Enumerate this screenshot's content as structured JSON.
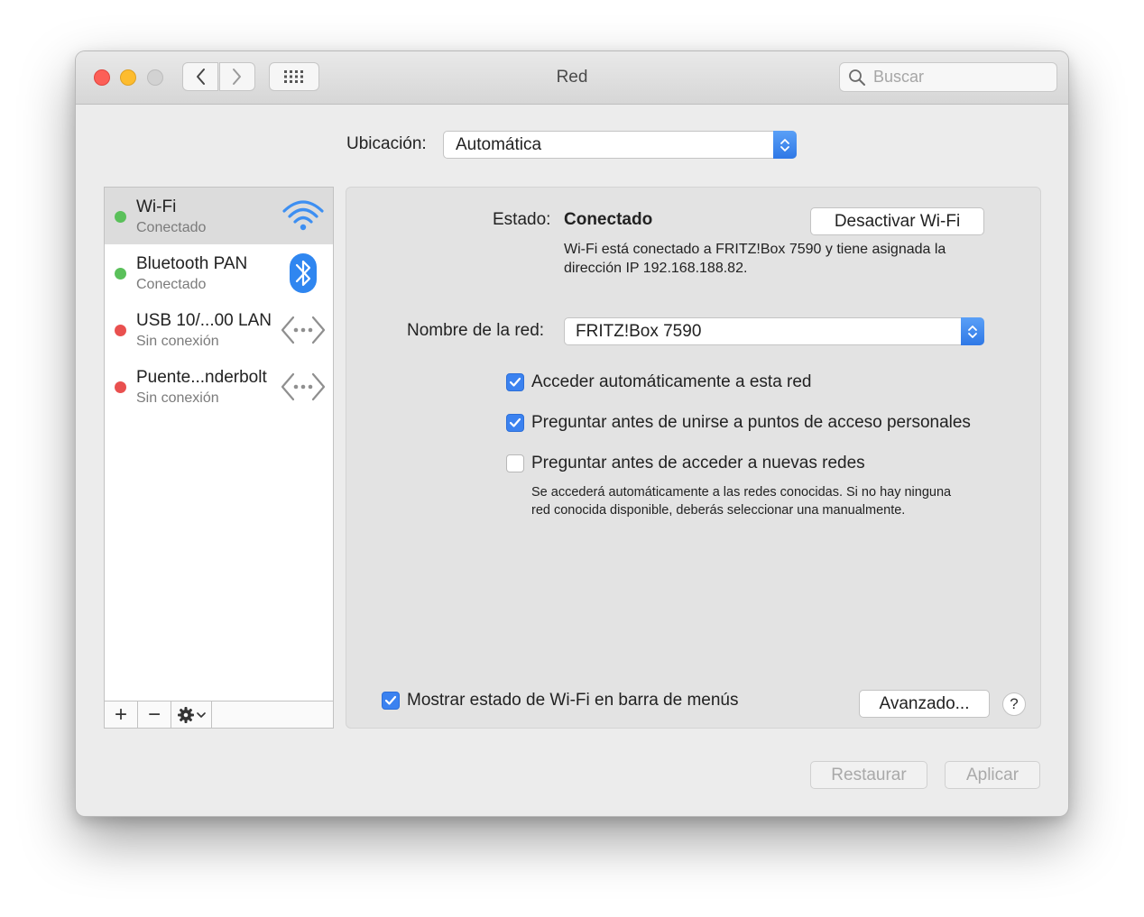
{
  "window": {
    "title": "Red"
  },
  "toolbar": {
    "search_placeholder": "Buscar"
  },
  "location": {
    "label": "Ubicación:",
    "value": "Automática"
  },
  "services": [
    {
      "name": "Wi-Fi",
      "status": "Conectado",
      "status_color": "#5ac05a",
      "icon": "wifi-icon"
    },
    {
      "name": "Bluetooth PAN",
      "status": "Conectado",
      "status_color": "#5ac05a",
      "icon": "bluetooth-icon"
    },
    {
      "name": "USB 10/...00 LAN",
      "status": "Sin conexión",
      "status_color": "#e9504f",
      "icon": "ethernet-arrows-icon"
    },
    {
      "name": "Puente...nderbolt",
      "status": "Sin conexión",
      "status_color": "#e9504f",
      "icon": "ethernet-arrows-icon"
    }
  ],
  "sidebar_tools": {
    "add": "+",
    "remove": "−"
  },
  "detail": {
    "estado_label": "Estado:",
    "estado_value": "Conectado",
    "toggle_button": "Desactivar Wi-Fi",
    "estado_desc": "Wi-Fi está conectado a FRITZ!Box 7590 y tiene asignada la dirección IP 192.168.188.82.",
    "network_label": "Nombre de la red:",
    "network_value": "FRITZ!Box 7590",
    "options": [
      {
        "label": "Acceder automáticamente a esta red",
        "checked": true
      },
      {
        "label": "Preguntar antes de unirse a puntos de acceso personales",
        "checked": true
      },
      {
        "label": "Preguntar antes de acceder a nuevas redes",
        "checked": false
      }
    ],
    "options_hint": "Se accederá automáticamente a las redes conocidas. Si no hay ninguna red conocida disponible, deberás seleccionar una manualmente.",
    "menu_bar_checkbox": {
      "label": "Mostrar estado de Wi-Fi en barra de menús",
      "checked": true
    },
    "advanced_button": "Avanzado...",
    "help_button": "?"
  },
  "footer": {
    "revert": "Restaurar",
    "apply": "Aplicar"
  },
  "colors": {
    "accent": "#3b82f0",
    "connected": "#5ac05a",
    "disconnected": "#e9504f"
  }
}
